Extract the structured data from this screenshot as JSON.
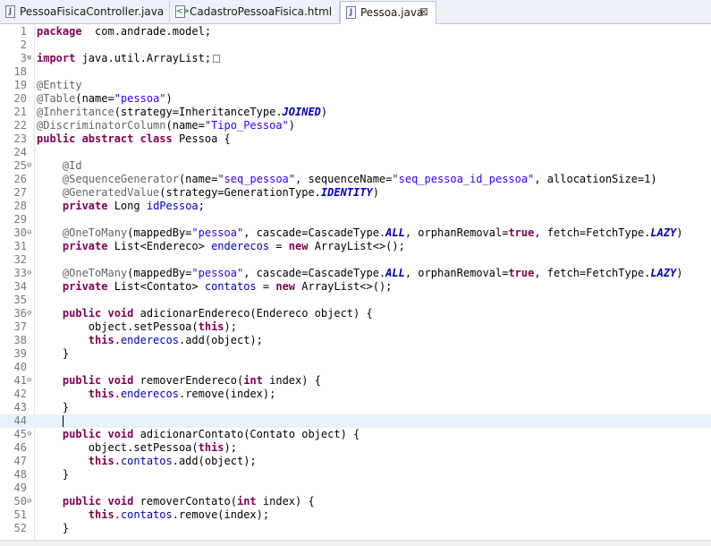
{
  "tabs": [
    {
      "label": "PessoaFisicaController.java",
      "icon": "java-file-icon",
      "active": false
    },
    {
      "label": "CadastroPessoaFisica.html",
      "icon": "html-file-icon",
      "active": false
    },
    {
      "label": "Pessoa.java",
      "icon": "java-file-icon",
      "active": true,
      "close": "⊠"
    }
  ],
  "editor": {
    "lines": [
      {
        "num": "1",
        "fold": "",
        "tokens": [
          [
            "kw",
            "package"
          ],
          [
            "",
            "  com.andrade.model;"
          ]
        ]
      },
      {
        "num": "2",
        "fold": "",
        "tokens": []
      },
      {
        "num": "3",
        "fold": "⊕",
        "tokens": [
          [
            "kw",
            "import"
          ],
          [
            "",
            " java.util.ArrayList;"
          ],
          [
            "collapsed",
            ""
          ]
        ]
      },
      {
        "num": "18",
        "fold": "",
        "tokens": []
      },
      {
        "num": "19",
        "fold": "",
        "tokens": [
          [
            "an",
            "@Entity"
          ]
        ]
      },
      {
        "num": "20",
        "fold": "",
        "tokens": [
          [
            "an",
            "@Table"
          ],
          [
            "",
            "(name="
          ],
          [
            "st",
            "\"pessoa\""
          ],
          [
            "",
            ")"
          ]
        ]
      },
      {
        "num": "21",
        "fold": "",
        "tokens": [
          [
            "an",
            "@Inheritance"
          ],
          [
            "",
            "(strategy=InheritanceType."
          ],
          [
            "ic",
            "JOINED"
          ],
          [
            "",
            ")"
          ]
        ]
      },
      {
        "num": "22",
        "fold": "",
        "tokens": [
          [
            "an",
            "@DiscriminatorColumn"
          ],
          [
            "",
            "(name="
          ],
          [
            "st",
            "\"Tipo_Pessoa\""
          ],
          [
            "",
            ")"
          ]
        ]
      },
      {
        "num": "23",
        "fold": "",
        "tokens": [
          [
            "kw",
            "public abstract class"
          ],
          [
            "",
            " Pessoa {"
          ]
        ]
      },
      {
        "num": "24",
        "fold": "",
        "tokens": []
      },
      {
        "num": "25",
        "fold": "⊖",
        "tokens": [
          [
            "",
            "    "
          ],
          [
            "an",
            "@Id"
          ]
        ]
      },
      {
        "num": "26",
        "fold": "",
        "tokens": [
          [
            "",
            "    "
          ],
          [
            "an",
            "@SequenceGenerator"
          ],
          [
            "",
            "(name="
          ],
          [
            "st",
            "\"seq_pessoa\""
          ],
          [
            "",
            ", sequenceName="
          ],
          [
            "st",
            "\"seq_pessoa_id_pessoa\""
          ],
          [
            "",
            ", allocationSize=1)"
          ]
        ]
      },
      {
        "num": "27",
        "fold": "",
        "tokens": [
          [
            "",
            "    "
          ],
          [
            "an",
            "@GeneratedValue"
          ],
          [
            "",
            "(strategy=GenerationType."
          ],
          [
            "ic",
            "IDENTITY"
          ],
          [
            "",
            ")"
          ]
        ]
      },
      {
        "num": "28",
        "fold": "",
        "tokens": [
          [
            "",
            "    "
          ],
          [
            "kw",
            "private"
          ],
          [
            "",
            " Long "
          ],
          [
            "fd",
            "idPessoa"
          ],
          [
            "",
            ";"
          ]
        ]
      },
      {
        "num": "29",
        "fold": "",
        "tokens": []
      },
      {
        "num": "30",
        "fold": "⊖",
        "tokens": [
          [
            "",
            "    "
          ],
          [
            "an",
            "@OneToMany"
          ],
          [
            "",
            "(mappedBy="
          ],
          [
            "st",
            "\"pessoa\""
          ],
          [
            "",
            ", cascade=CascadeType."
          ],
          [
            "ic",
            "ALL"
          ],
          [
            "",
            ", orphanRemoval="
          ],
          [
            "kw",
            "true"
          ],
          [
            "",
            ", fetch=FetchType."
          ],
          [
            "ic",
            "LAZY"
          ],
          [
            "",
            ")"
          ]
        ]
      },
      {
        "num": "31",
        "fold": "",
        "tokens": [
          [
            "",
            "    "
          ],
          [
            "kw",
            "private"
          ],
          [
            "",
            " List<Endereco> "
          ],
          [
            "fd",
            "enderecos"
          ],
          [
            "",
            " = "
          ],
          [
            "kw",
            "new"
          ],
          [
            "",
            " ArrayList<>();"
          ]
        ]
      },
      {
        "num": "32",
        "fold": "",
        "tokens": []
      },
      {
        "num": "33",
        "fold": "⊖",
        "tokens": [
          [
            "",
            "    "
          ],
          [
            "an",
            "@OneToMany"
          ],
          [
            "",
            "(mappedBy="
          ],
          [
            "st",
            "\"pessoa\""
          ],
          [
            "",
            ", cascade=CascadeType."
          ],
          [
            "ic",
            "ALL"
          ],
          [
            "",
            ", orphanRemoval="
          ],
          [
            "kw",
            "true"
          ],
          [
            "",
            ", fetch=FetchType."
          ],
          [
            "ic",
            "LAZY"
          ],
          [
            "",
            ")"
          ]
        ]
      },
      {
        "num": "34",
        "fold": "",
        "tokens": [
          [
            "",
            "    "
          ],
          [
            "kw",
            "private"
          ],
          [
            "",
            " List<Contato> "
          ],
          [
            "fd",
            "contatos"
          ],
          [
            "",
            " = "
          ],
          [
            "kw",
            "new"
          ],
          [
            "",
            " ArrayList<>();"
          ]
        ]
      },
      {
        "num": "35",
        "fold": "",
        "tokens": []
      },
      {
        "num": "36",
        "fold": "⊖",
        "tokens": [
          [
            "",
            "    "
          ],
          [
            "kw",
            "public void"
          ],
          [
            "",
            " adicionarEndereco(Endereco object) {"
          ]
        ]
      },
      {
        "num": "37",
        "fold": "",
        "tokens": [
          [
            "",
            "        object.setPessoa("
          ],
          [
            "kw",
            "this"
          ],
          [
            "",
            ");"
          ]
        ]
      },
      {
        "num": "38",
        "fold": "",
        "tokens": [
          [
            "",
            "        "
          ],
          [
            "kw",
            "this"
          ],
          [
            "",
            "."
          ],
          [
            "fd",
            "enderecos"
          ],
          [
            "",
            ".add(object);"
          ]
        ]
      },
      {
        "num": "39",
        "fold": "",
        "tokens": [
          [
            "",
            "    }"
          ]
        ]
      },
      {
        "num": "40",
        "fold": "",
        "tokens": []
      },
      {
        "num": "41",
        "fold": "⊖",
        "tokens": [
          [
            "",
            "    "
          ],
          [
            "kw",
            "public void"
          ],
          [
            "",
            " removerEndereco("
          ],
          [
            "kw",
            "int"
          ],
          [
            "",
            " index) {"
          ]
        ]
      },
      {
        "num": "42",
        "fold": "",
        "tokens": [
          [
            "",
            "        "
          ],
          [
            "kw",
            "this"
          ],
          [
            "",
            "."
          ],
          [
            "fd",
            "enderecos"
          ],
          [
            "",
            ".remove(index);"
          ]
        ]
      },
      {
        "num": "43",
        "fold": "",
        "tokens": [
          [
            "",
            "    }"
          ]
        ]
      },
      {
        "num": "44",
        "fold": "",
        "current": true,
        "tokens": [
          [
            "",
            "    "
          ],
          [
            "caret",
            ""
          ]
        ]
      },
      {
        "num": "45",
        "fold": "⊖",
        "tokens": [
          [
            "",
            "    "
          ],
          [
            "kw",
            "public void"
          ],
          [
            "",
            " adicionarContato(Contato object) {"
          ]
        ]
      },
      {
        "num": "46",
        "fold": "",
        "tokens": [
          [
            "",
            "        object.setPessoa("
          ],
          [
            "kw",
            "this"
          ],
          [
            "",
            ");"
          ]
        ]
      },
      {
        "num": "47",
        "fold": "",
        "tokens": [
          [
            "",
            "        "
          ],
          [
            "kw",
            "this"
          ],
          [
            "",
            "."
          ],
          [
            "fd",
            "contatos"
          ],
          [
            "",
            ".add(object);"
          ]
        ]
      },
      {
        "num": "48",
        "fold": "",
        "tokens": [
          [
            "",
            "    }"
          ]
        ]
      },
      {
        "num": "49",
        "fold": "",
        "tokens": []
      },
      {
        "num": "50",
        "fold": "⊖",
        "tokens": [
          [
            "",
            "    "
          ],
          [
            "kw",
            "public void"
          ],
          [
            "",
            " removerContato("
          ],
          [
            "kw",
            "int"
          ],
          [
            "",
            " index) {"
          ]
        ]
      },
      {
        "num": "51",
        "fold": "",
        "tokens": [
          [
            "",
            "        "
          ],
          [
            "kw",
            "this"
          ],
          [
            "",
            "."
          ],
          [
            "fd",
            "contatos"
          ],
          [
            "",
            ".remove(index);"
          ]
        ]
      },
      {
        "num": "52",
        "fold": "",
        "tokens": [
          [
            "",
            "    }"
          ]
        ]
      }
    ]
  },
  "colors": {
    "keyword": "#7f0055",
    "annotation": "#646464",
    "string": "#2a00ff",
    "field": "#0000c0",
    "current_line": "#e8f2fe"
  }
}
